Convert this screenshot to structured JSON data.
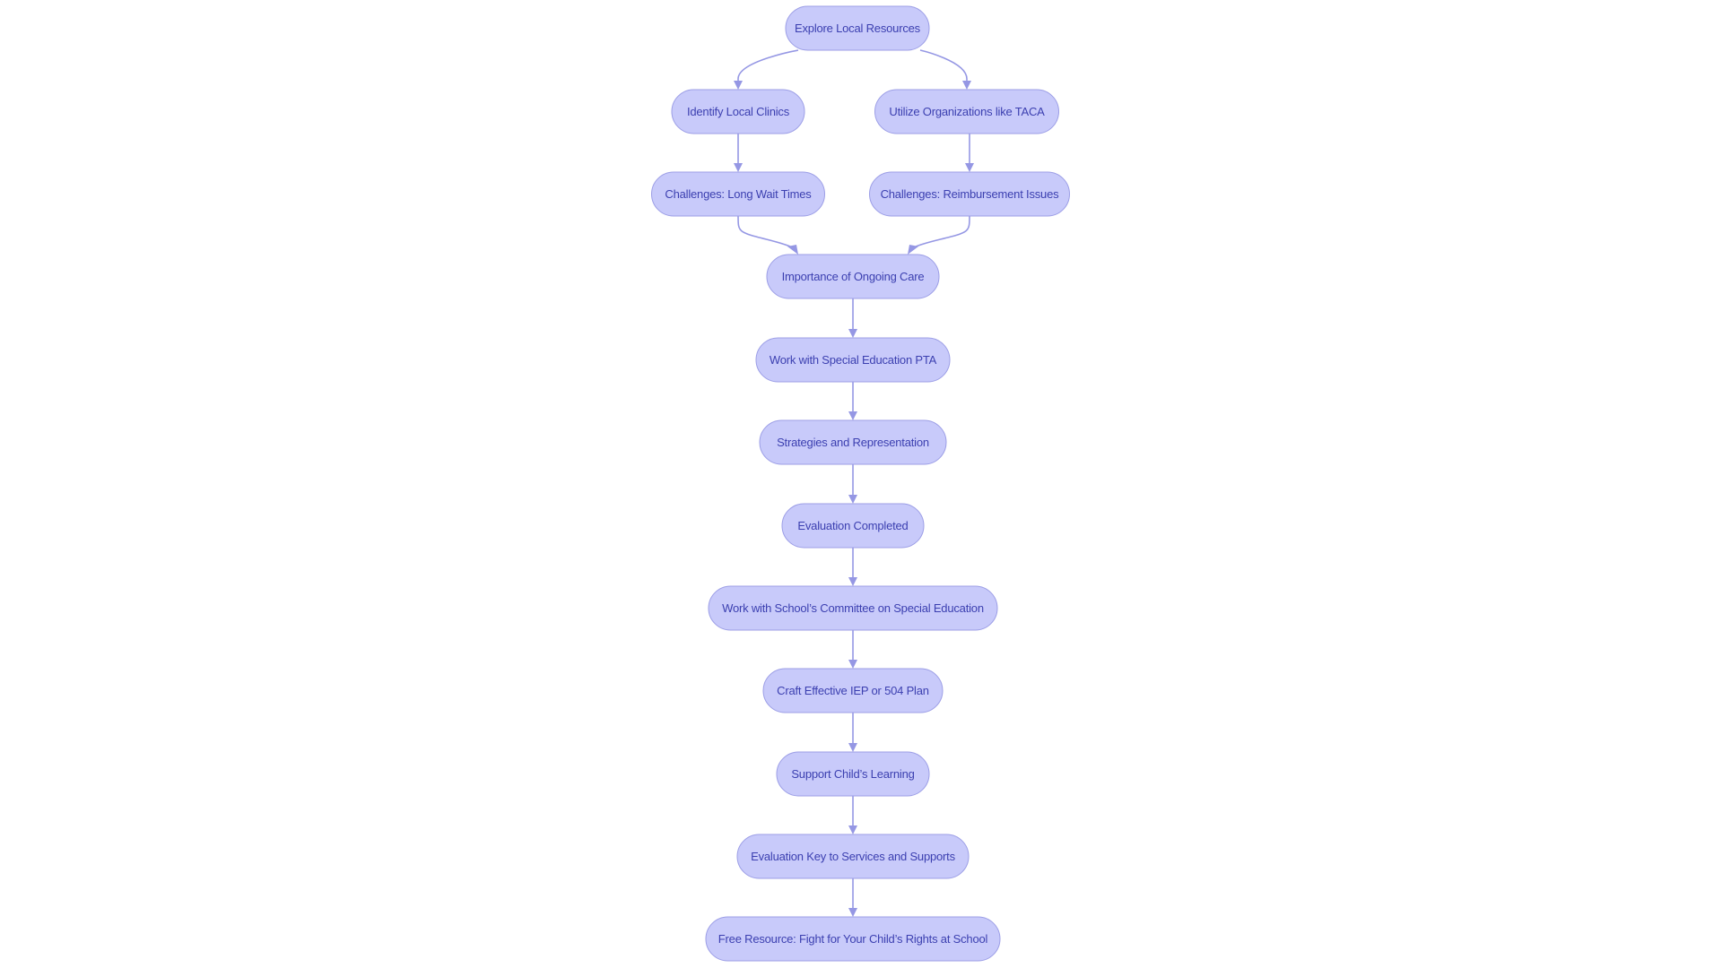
{
  "diagram": {
    "type": "flowchart",
    "direction": "top-down",
    "colors": {
      "node_fill": "#C8CAFA",
      "node_border": "#9C9EE6",
      "node_text": "#3B3FB0",
      "edge": "#9597E4",
      "background": "#FFFFFF"
    },
    "nodes": [
      {
        "id": "n0",
        "label": "Explore Local Resources"
      },
      {
        "id": "n1",
        "label": "Identify Local Clinics"
      },
      {
        "id": "n2",
        "label": "Utilize Organizations like TACA"
      },
      {
        "id": "n3",
        "label": "Challenges: Long Wait Times"
      },
      {
        "id": "n4",
        "label": "Challenges: Reimbursement Issues"
      },
      {
        "id": "n5",
        "label": "Importance of Ongoing Care"
      },
      {
        "id": "n6",
        "label": "Work with Special Education PTA"
      },
      {
        "id": "n7",
        "label": "Strategies and Representation"
      },
      {
        "id": "n8",
        "label": "Evaluation Completed"
      },
      {
        "id": "n9",
        "label": "Work with School’s Committee on Special Education"
      },
      {
        "id": "n10",
        "label": "Craft Effective IEP or 504 Plan"
      },
      {
        "id": "n11",
        "label": "Support Child’s Learning"
      },
      {
        "id": "n12",
        "label": "Evaluation Key to Services and Supports"
      },
      {
        "id": "n13",
        "label": "Free Resource: Fight for Your Child’s Rights at School"
      }
    ],
    "edges": [
      {
        "from": "n0",
        "to": "n1"
      },
      {
        "from": "n0",
        "to": "n2"
      },
      {
        "from": "n1",
        "to": "n3"
      },
      {
        "from": "n2",
        "to": "n4"
      },
      {
        "from": "n3",
        "to": "n5"
      },
      {
        "from": "n4",
        "to": "n5"
      },
      {
        "from": "n5",
        "to": "n6"
      },
      {
        "from": "n6",
        "to": "n7"
      },
      {
        "from": "n7",
        "to": "n8"
      },
      {
        "from": "n8",
        "to": "n9"
      },
      {
        "from": "n9",
        "to": "n10"
      },
      {
        "from": "n10",
        "to": "n11"
      },
      {
        "from": "n11",
        "to": "n12"
      },
      {
        "from": "n12",
        "to": "n13"
      }
    ]
  }
}
